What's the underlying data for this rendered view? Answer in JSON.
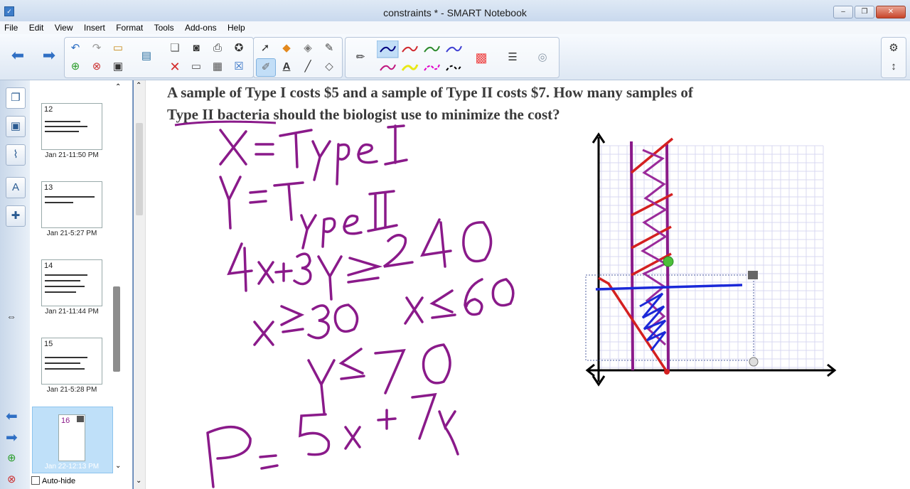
{
  "window": {
    "title": "constraints * - SMART Notebook"
  },
  "menu": [
    "File",
    "Edit",
    "View",
    "Insert",
    "Format",
    "Tools",
    "Add-ons",
    "Help"
  ],
  "toolbar": {
    "icons": [
      "back-arrow-icon",
      "forward-arrow-icon",
      "undo-icon",
      "redo-icon",
      "open-icon",
      "add-page-icon",
      "delete-page-icon",
      "save-icon",
      "screen-share-icon",
      "paste-icon",
      "screenshade-icon",
      "capture-icon",
      "magic-icon",
      "delete-icon",
      "table-icon",
      "close-icon",
      "select-icon",
      "fill-icon",
      "eraser-icon",
      "pen-icon",
      "creative-pen-icon",
      "text-icon",
      "line-icon",
      "shape-eraser-icon",
      "pen-style-icon",
      "color-palette-icon",
      "line-style-icon",
      "transparency-icon",
      "settings-icon",
      "toolbar-move-icon"
    ],
    "pen_colors": [
      "#000080",
      "#d0282e",
      "#2c8a2c",
      "#3f3fd2",
      "#c0177f",
      "#e8e818",
      "#e000c8",
      "#000000"
    ]
  },
  "sidebar": {
    "tabs": [
      "page-sorter-icon",
      "gallery-icon",
      "attachments-icon",
      "properties-icon",
      "addons-icon"
    ],
    "pages": [
      {
        "number": "12",
        "label": "Jan 21-11:50 PM"
      },
      {
        "number": "13",
        "label": "Jan 21-5:27 PM"
      },
      {
        "number": "14",
        "label": "Jan 21-11:44 PM"
      },
      {
        "number": "15",
        "label": "Jan 21-5:28 PM"
      },
      {
        "number": "16",
        "label": "Jan 22-12:13 PM"
      }
    ],
    "autohide_label": "Auto-hide"
  },
  "canvas": {
    "question_line1": "A sample of Type I costs $5 and a sample of Type II costs $7. How many samples of",
    "question_line2": "Type II bacteria should the biologist use to minimize the cost?",
    "ink_color": "#8a1a8a",
    "handwriting": [
      "X = Type I",
      "Y = Type II",
      "4x+3y ≥ 240",
      "x ≥ 30",
      "x ≤ 60",
      "y ≤ 70",
      "P = 5x+7y"
    ]
  }
}
